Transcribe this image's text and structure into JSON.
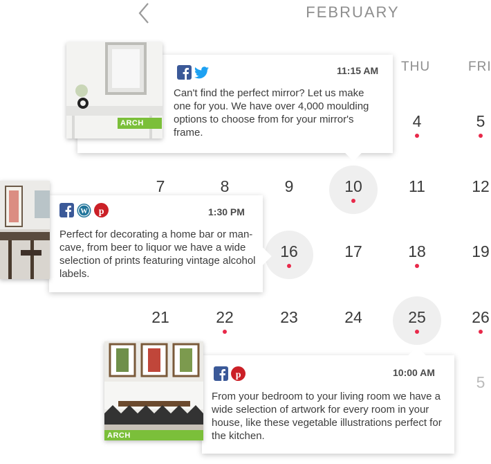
{
  "calendar": {
    "month": "FEBRUARY",
    "weekday_headers": [
      "THU",
      "FRI"
    ],
    "days": [
      {
        "label": "4",
        "has_post": true
      },
      {
        "label": "5",
        "has_post": true
      },
      {
        "label": "7",
        "has_post": false
      },
      {
        "label": "8",
        "has_post": false
      },
      {
        "label": "9",
        "has_post": false
      },
      {
        "label": "10",
        "has_post": true,
        "selected": true
      },
      {
        "label": "11",
        "has_post": false
      },
      {
        "label": "12",
        "has_post": false
      },
      {
        "label": "16",
        "has_post": true,
        "selected": true
      },
      {
        "label": "17",
        "has_post": false
      },
      {
        "label": "18",
        "has_post": true
      },
      {
        "label": "19",
        "has_post": false
      },
      {
        "label": "21",
        "has_post": false
      },
      {
        "label": "22",
        "has_post": true
      },
      {
        "label": "23",
        "has_post": false
      },
      {
        "label": "24",
        "has_post": false
      },
      {
        "label": "25",
        "has_post": true,
        "selected": true
      },
      {
        "label": "26",
        "has_post": true
      },
      {
        "label": "5",
        "has_post": false,
        "faded": true
      }
    ],
    "post_dot_color": "#e8294a"
  },
  "posts": [
    {
      "time": "11:15 AM",
      "networks": [
        "facebook-icon",
        "twitter-icon"
      ],
      "message": "Can't find the perfect mirror? Let us make one for you. We have over 4,000 moulding options to choose from for your mirror's frame.",
      "image_brand": "ARCH"
    },
    {
      "time": "1:30 PM",
      "networks": [
        "facebook-icon",
        "wordpress-icon",
        "pinterest-icon"
      ],
      "message": "Perfect for decorating a home bar or man-cave, from beer to liquor we have a wide selection of prints featuring vintage alcohol labels."
    },
    {
      "time": "10:00 AM",
      "networks": [
        "facebook-icon",
        "pinterest-icon"
      ],
      "message": "From your bedroom to your living room we have a wide selection of artwork for every room in your house, like these vegetable illustrations perfect for the kitchen.",
      "image_brand": "ARCH"
    }
  ],
  "colors": {
    "facebook": "#3b5998",
    "twitter": "#1da1f2",
    "wordpress": "#21759b",
    "pinterest": "#cb2027",
    "brand_green": "#7bbf3a"
  }
}
